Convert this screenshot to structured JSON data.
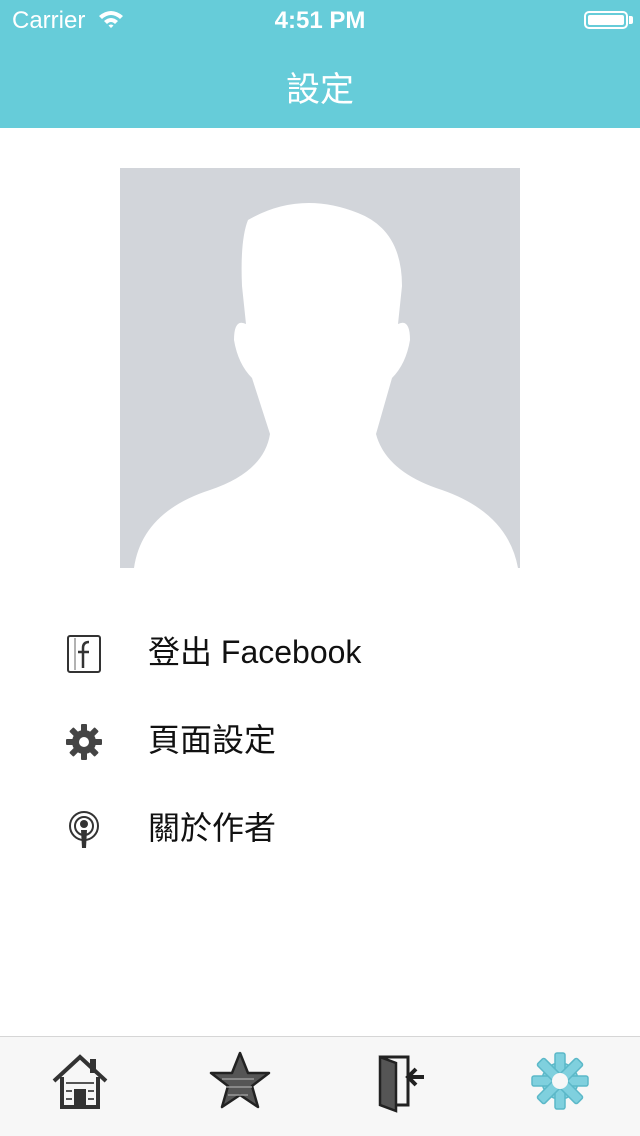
{
  "status_bar": {
    "carrier": "Carrier",
    "time": "4:51 PM"
  },
  "nav": {
    "title": "設定"
  },
  "menu": {
    "items": [
      {
        "label": "登出 Facebook",
        "icon": "facebook-icon"
      },
      {
        "label": "頁面設定",
        "icon": "gear-icon"
      },
      {
        "label": "關於作者",
        "icon": "podcast-icon"
      }
    ]
  },
  "tab_bar": {
    "items": [
      {
        "icon": "home-icon",
        "selected": false
      },
      {
        "icon": "star-icon",
        "selected": false
      },
      {
        "icon": "exit-door-icon",
        "selected": false
      },
      {
        "icon": "gear-icon",
        "selected": true
      }
    ]
  },
  "colors": {
    "header": "#66ccd9",
    "avatar_bg": "#d2d5da",
    "tab_selected": "#7fd0de",
    "tab_unselected": "#333333"
  }
}
